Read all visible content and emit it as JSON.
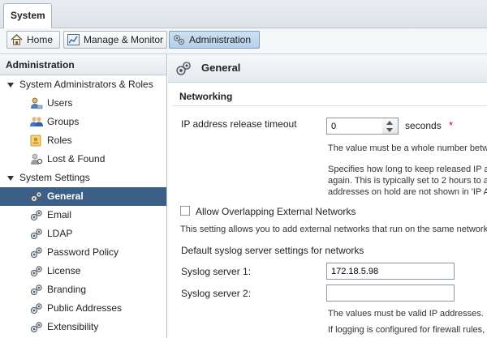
{
  "top_tab": {
    "label": "System"
  },
  "toolbar": {
    "home_label": "Home",
    "manage_label": "Manage & Monitor",
    "admin_label": "Administration"
  },
  "leftnav": {
    "title": "Administration",
    "group1": {
      "label": "System Administrators & Roles",
      "items": [
        "Users",
        "Groups",
        "Roles",
        "Lost & Found"
      ]
    },
    "group2": {
      "label": "System Settings",
      "items": [
        "General",
        "Email",
        "LDAP",
        "Password Policy",
        "License",
        "Branding",
        "Public Addresses",
        "Extensibility"
      ]
    },
    "selected": "General"
  },
  "main": {
    "title": "General",
    "section": "Networking",
    "ip_release": {
      "label": "IP address release timeout",
      "value": "0",
      "unit": "seconds",
      "required_mark": "*",
      "help1": "The value must be a whole number betw",
      "help2_lines": [
        "Specifies how long to keep released IP a",
        "again. This is typically set to 2 hours to a",
        "addresses on hold are not shown in 'IP A"
      ]
    },
    "overlap": {
      "label": "Allow Overlapping External Networks",
      "checked": false,
      "help": "This setting allows you to add external networks that run on the same network"
    },
    "syslog": {
      "heading": "Default syslog server settings for networks",
      "server1_label": "Syslog server 1:",
      "server1_value": "172.18.5.98",
      "server2_label": "Syslog server 2:",
      "server2_value": "",
      "help1": "The values must be valid IP addresses.",
      "help2": "If logging is configured for firewall rules,"
    }
  }
}
